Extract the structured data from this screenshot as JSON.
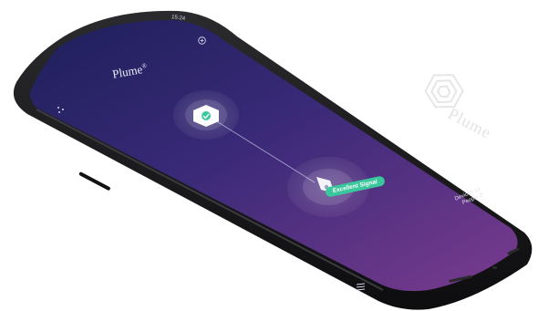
{
  "app": {
    "brand": "Plume",
    "brand_mark": "®",
    "status_time": "15:24",
    "menu_icon": "dots-grid-icon",
    "settings_icon": "circle-plus-icon",
    "nav_icon": "hamburger-icon"
  },
  "network": {
    "status_pill": "Excellent Signal",
    "devices_label": "Devices 14",
    "people_label": "People 3",
    "pill_color": "#39c79b"
  },
  "background": {
    "watermark_text": "Plume"
  }
}
